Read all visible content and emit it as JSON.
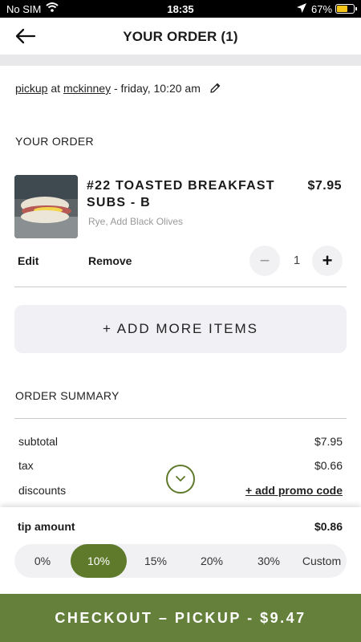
{
  "status_bar": {
    "carrier": "No SIM",
    "time": "18:35",
    "battery": "67%",
    "battery_level": 0.67
  },
  "header": {
    "title": "YOUR ORDER (1)"
  },
  "pickup": {
    "mode": "pickup",
    "at": " at ",
    "location": "mckinney",
    "when": " - friday, 10:20 am"
  },
  "order": {
    "heading": "YOUR ORDER",
    "item": {
      "name": "#22 TOASTED BREAKFAST SUBS - B",
      "price": "$7.95",
      "modifiers": "Rye, Add Black Olives",
      "quantity": "1"
    },
    "edit_label": "Edit",
    "remove_label": "Remove",
    "minus_label": "−",
    "plus_label": "+"
  },
  "add_more_label": "+ ADD MORE ITEMS",
  "summary": {
    "heading": "ORDER SUMMARY",
    "subtotal_label": "subtotal",
    "subtotal": "$7.95",
    "tax_label": "tax",
    "tax": "$0.66",
    "discounts_label": "discounts",
    "promo_label": "+ add promo code"
  },
  "tip": {
    "label": "tip amount",
    "amount": "$0.86",
    "options": [
      "0%",
      "10%",
      "15%",
      "20%",
      "30%",
      "Custom"
    ],
    "selected": "10%"
  },
  "checkout_label": "CHECKOUT – PICKUP - $9.47",
  "colors": {
    "accent": "#5e7a2a",
    "checkout": "#64803a"
  },
  "icons": [
    "wifi-icon",
    "location-arrow-icon",
    "battery-icon",
    "back-arrow-icon",
    "pencil-icon",
    "chevron-down-icon"
  ]
}
